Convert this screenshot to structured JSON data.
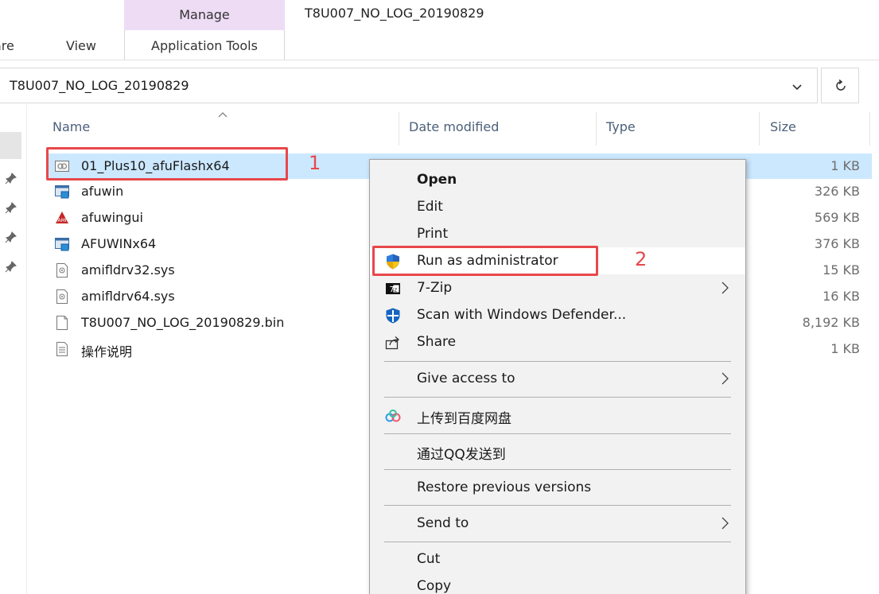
{
  "window": {
    "title": "T8U007_NO_LOG_20190829"
  },
  "ribbon": {
    "context_label": "Manage",
    "context_tab": "Application Tools",
    "tabs": [
      "are",
      "View"
    ]
  },
  "address": {
    "path": "T8U007_NO_LOG_20190829"
  },
  "columns": {
    "name": "Name",
    "date": "Date modified",
    "type": "Type",
    "size": "Size"
  },
  "files": [
    {
      "name": "01_Plus10_afuFlashx64",
      "size": "1 KB",
      "icon": "shortcut-settings-icon",
      "selected": true
    },
    {
      "name": "afuwin",
      "size": "326 KB",
      "icon": "application-icon"
    },
    {
      "name": "afuwingui",
      "size": "569 KB",
      "icon": "ami-application-icon"
    },
    {
      "name": "AFUWINx64",
      "size": "376 KB",
      "icon": "application-icon"
    },
    {
      "name": "amifldrv32.sys",
      "size": "15 KB",
      "icon": "system-file-icon"
    },
    {
      "name": "amifldrv64.sys",
      "size": "16 KB",
      "icon": "system-file-icon"
    },
    {
      "name": "T8U007_NO_LOG_20190829.bin",
      "size": "8,192 KB",
      "icon": "blank-file-icon"
    },
    {
      "name": "操作说明",
      "size": "1 KB",
      "icon": "text-file-icon"
    }
  ],
  "annotations": {
    "step1": "1",
    "step2": "2"
  },
  "context_menu": {
    "items": [
      {
        "label": "Open",
        "bold": true
      },
      {
        "label": "Edit"
      },
      {
        "label": "Print"
      },
      {
        "label": "Run as administrator",
        "icon": "uac-shield-icon"
      },
      {
        "label": "7-Zip",
        "icon": "7zip-icon",
        "submenu": true
      },
      {
        "label": "Scan with Windows Defender...",
        "icon": "defender-icon"
      },
      {
        "label": "Share",
        "icon": "share-icon"
      },
      {
        "label": "Give access to",
        "submenu": true
      },
      {
        "label": "上传到百度网盘",
        "icon": "baidu-cloud-icon"
      },
      {
        "label": "通过QQ发送到"
      },
      {
        "label": "Restore previous versions"
      },
      {
        "label": "Send to",
        "submenu": true
      },
      {
        "label": "Cut"
      },
      {
        "label": "Copy"
      }
    ]
  },
  "colors": {
    "selection": "#cce8ff",
    "highlight": "#e8474b",
    "context_tab": "#eedcf5"
  }
}
